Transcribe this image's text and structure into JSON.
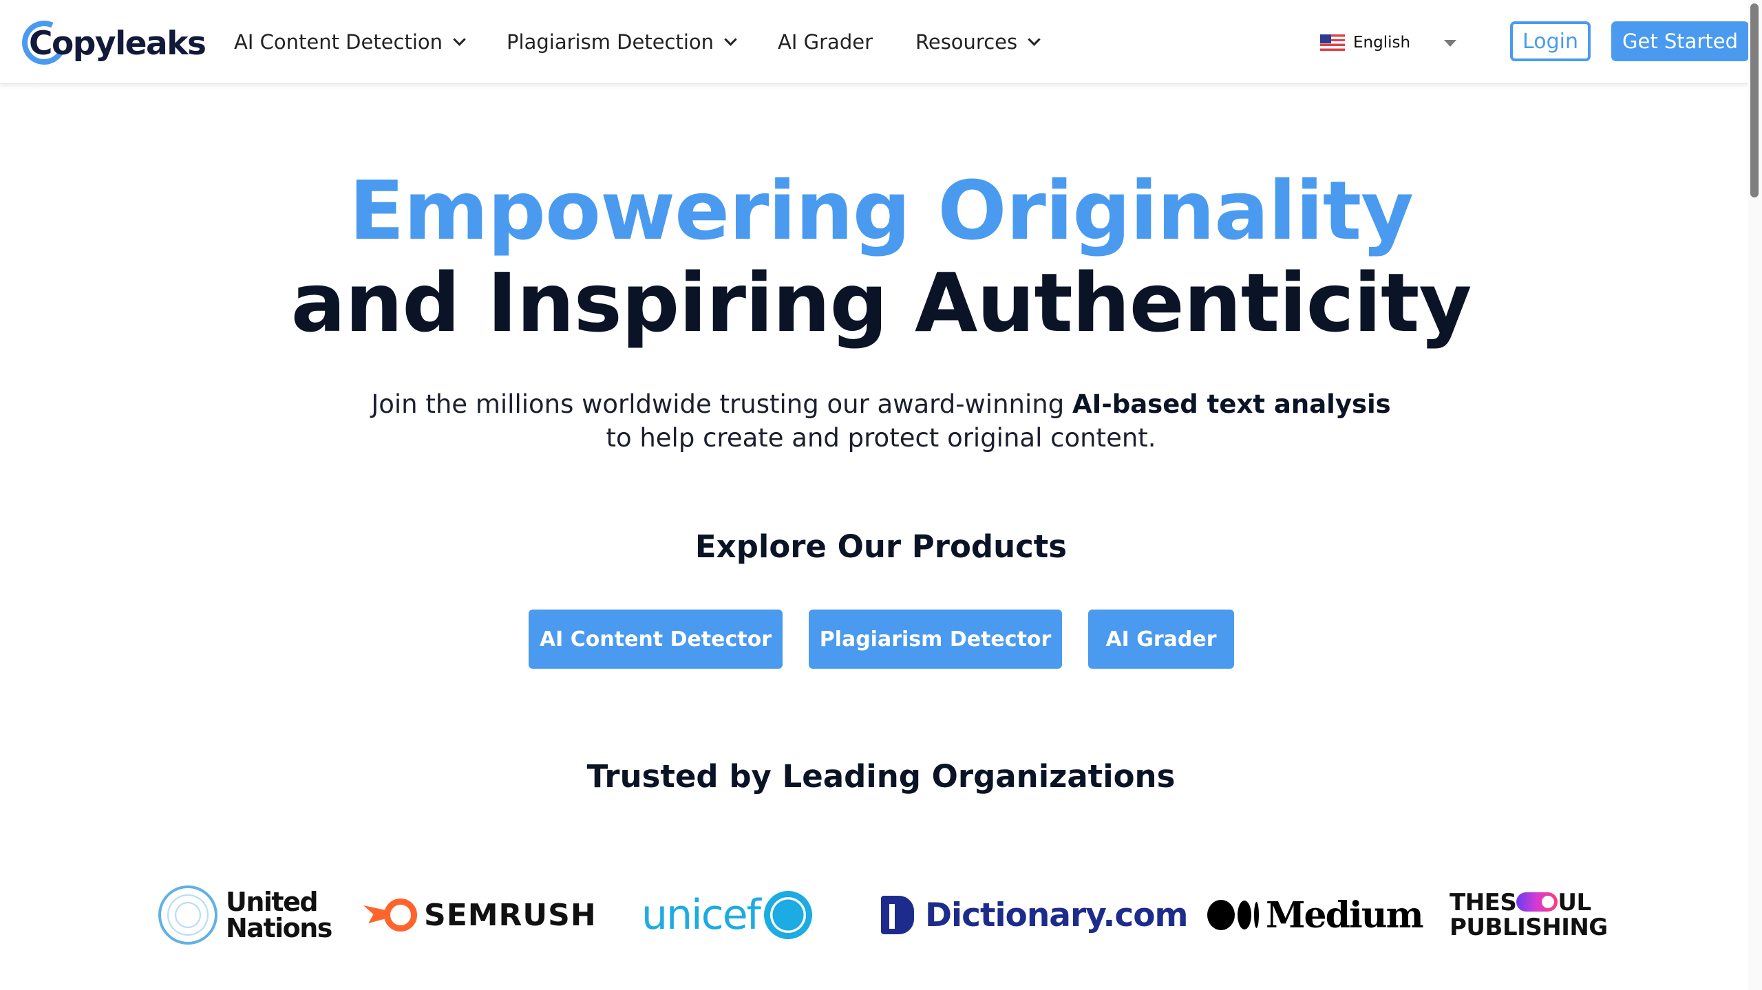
{
  "header": {
    "brand": "Copyleaks",
    "nav": [
      {
        "label": "AI Content Detection",
        "has_dropdown": true
      },
      {
        "label": "Plagiarism Detection",
        "has_dropdown": true
      },
      {
        "label": "AI Grader",
        "has_dropdown": false
      },
      {
        "label": "Resources",
        "has_dropdown": true
      }
    ],
    "language": {
      "selected": "English",
      "flag_icon": "us-flag-icon"
    },
    "login_label": "Login",
    "get_started_label": "Get Started"
  },
  "hero": {
    "title_line1": "Empowering Originality",
    "title_line2": "and Inspiring Authenticity",
    "subtitle_prefix": "Join the millions worldwide trusting our award-winning ",
    "subtitle_bold": "AI-based text analysis",
    "subtitle_line2": "to help create and protect original content."
  },
  "products": {
    "title": "Explore Our Products",
    "buttons": [
      "AI Content Detector",
      "Plagiarism Detector",
      "AI Grader"
    ]
  },
  "trusted": {
    "title": "Trusted by Leading Organizations",
    "organizations": [
      {
        "name": "United Nations",
        "line1": "United",
        "line2": "Nations"
      },
      {
        "name": "SEMRUSH"
      },
      {
        "name": "unicef"
      },
      {
        "name": "Dictionary.com"
      },
      {
        "name": "Medium"
      },
      {
        "name": "TheSoul Publishing",
        "line1_a": "THES",
        "line1_b": "UL",
        "line2": "PUBLISHING"
      }
    ]
  },
  "colors": {
    "accent": "#4a9af0",
    "heading": "#0b1426"
  }
}
